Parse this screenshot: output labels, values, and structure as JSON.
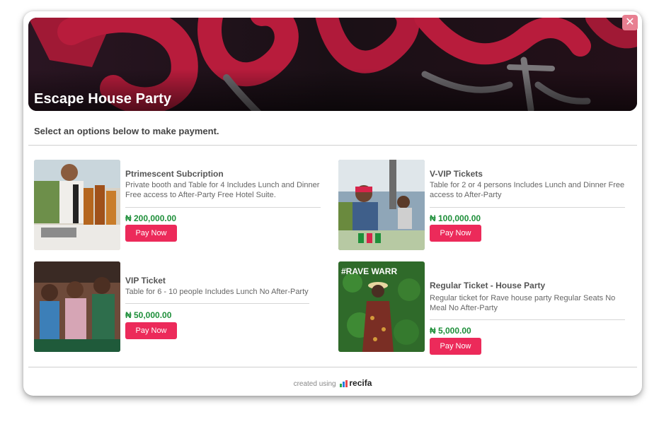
{
  "modal": {
    "close_glyph": "✕",
    "banner_title": "Escape House Party",
    "subtitle": "Select an options below to make payment."
  },
  "tickets": [
    {
      "name": "Ptrimescent Subcription",
      "description": "Private booth and Table for 4 Includes Lunch and Dinner Free access to After-Party Free Hotel Suite.",
      "price": "₦ 200,000.00",
      "button": "Pay Now"
    },
    {
      "name": "V-VIP Tickets",
      "description": "Table for 2 or 4 persons Includes Lunch and Dinner Free access to After-Party",
      "price": "₦ 100,000.00",
      "button": "Pay Now"
    },
    {
      "name": "VIP Ticket",
      "description": "Table for 6 - 10 people Includes Lunch No After-Party",
      "price": "₦ 50,000.00",
      "button": "Pay Now"
    },
    {
      "name": "Regular Ticket - House Party",
      "description": "Regular ticket for Rave house party Regular Seats No Meal No After-Party",
      "price": "₦ 5,000.00",
      "button": "Pay Now",
      "image_text": "#RAVE WARR"
    }
  ],
  "footer": {
    "prefix": "created using",
    "brand": "recifa"
  },
  "colors": {
    "accent": "#ec2a5a",
    "price": "#1e8f3a",
    "close": "#e87f91"
  }
}
